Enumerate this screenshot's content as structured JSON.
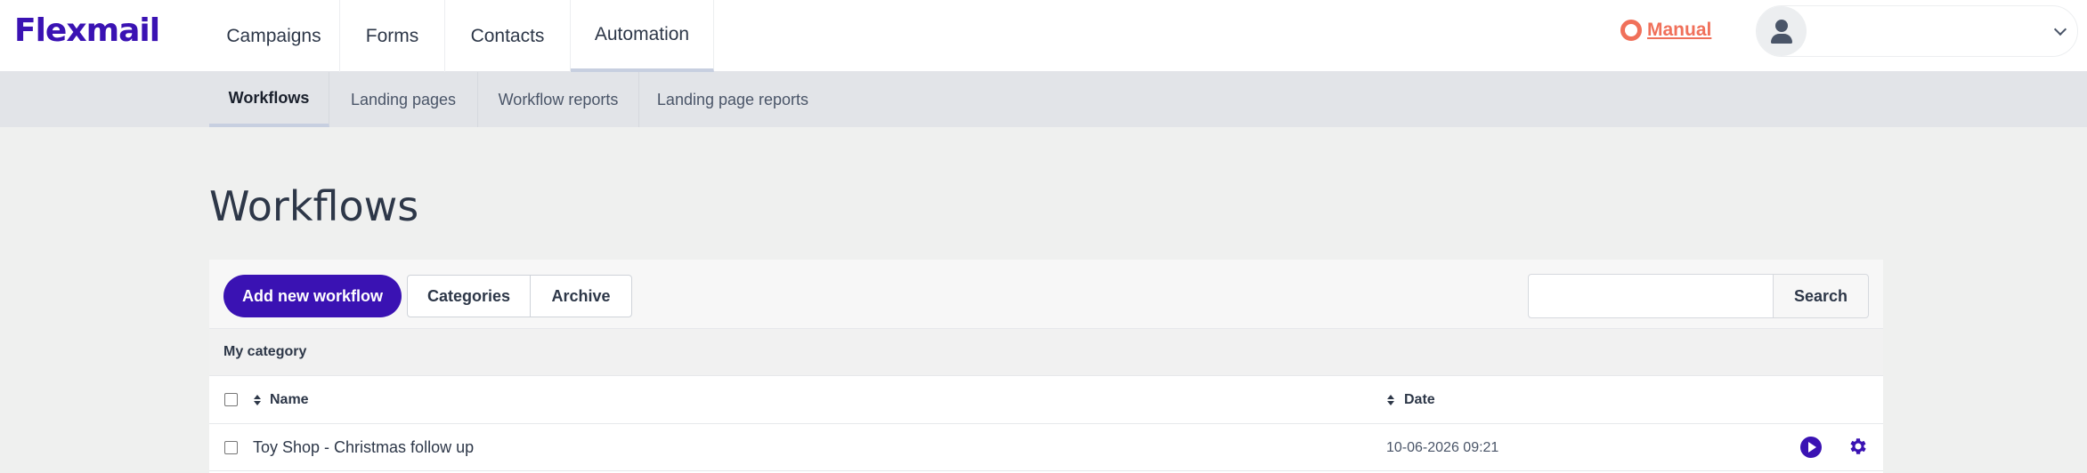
{
  "app": {
    "logo": "Flexmail"
  },
  "topnav": {
    "tabs": [
      {
        "label": "Campaigns"
      },
      {
        "label": "Forms"
      },
      {
        "label": "Contacts"
      },
      {
        "label": "Automation",
        "active": true
      }
    ],
    "manual_label": "Manual",
    "user_name": ""
  },
  "subnav": {
    "tabs": [
      {
        "label": "Workflows",
        "active": true
      },
      {
        "label": "Landing pages"
      },
      {
        "label": "Workflow reports"
      },
      {
        "label": "Landing page reports"
      }
    ]
  },
  "page": {
    "title": "Workflows"
  },
  "toolbar": {
    "add_label": "Add new workflow",
    "categories_label": "Categories",
    "archive_label": "Archive",
    "search_value": "",
    "search_placeholder": "",
    "search_label": "Search"
  },
  "table": {
    "category": "My category",
    "columns": {
      "name": "Name",
      "date": "Date"
    },
    "rows": [
      {
        "name": "Toy Shop - Christmas follow up",
        "date": "10-06-2026 09:21"
      }
    ]
  },
  "colors": {
    "brand": "#3a12b3",
    "manual": "#f0705a"
  },
  "icons": [
    "lifebuoy-icon",
    "user-icon",
    "chevron-down-icon",
    "sort-icon",
    "play-icon",
    "gear-icon"
  ]
}
